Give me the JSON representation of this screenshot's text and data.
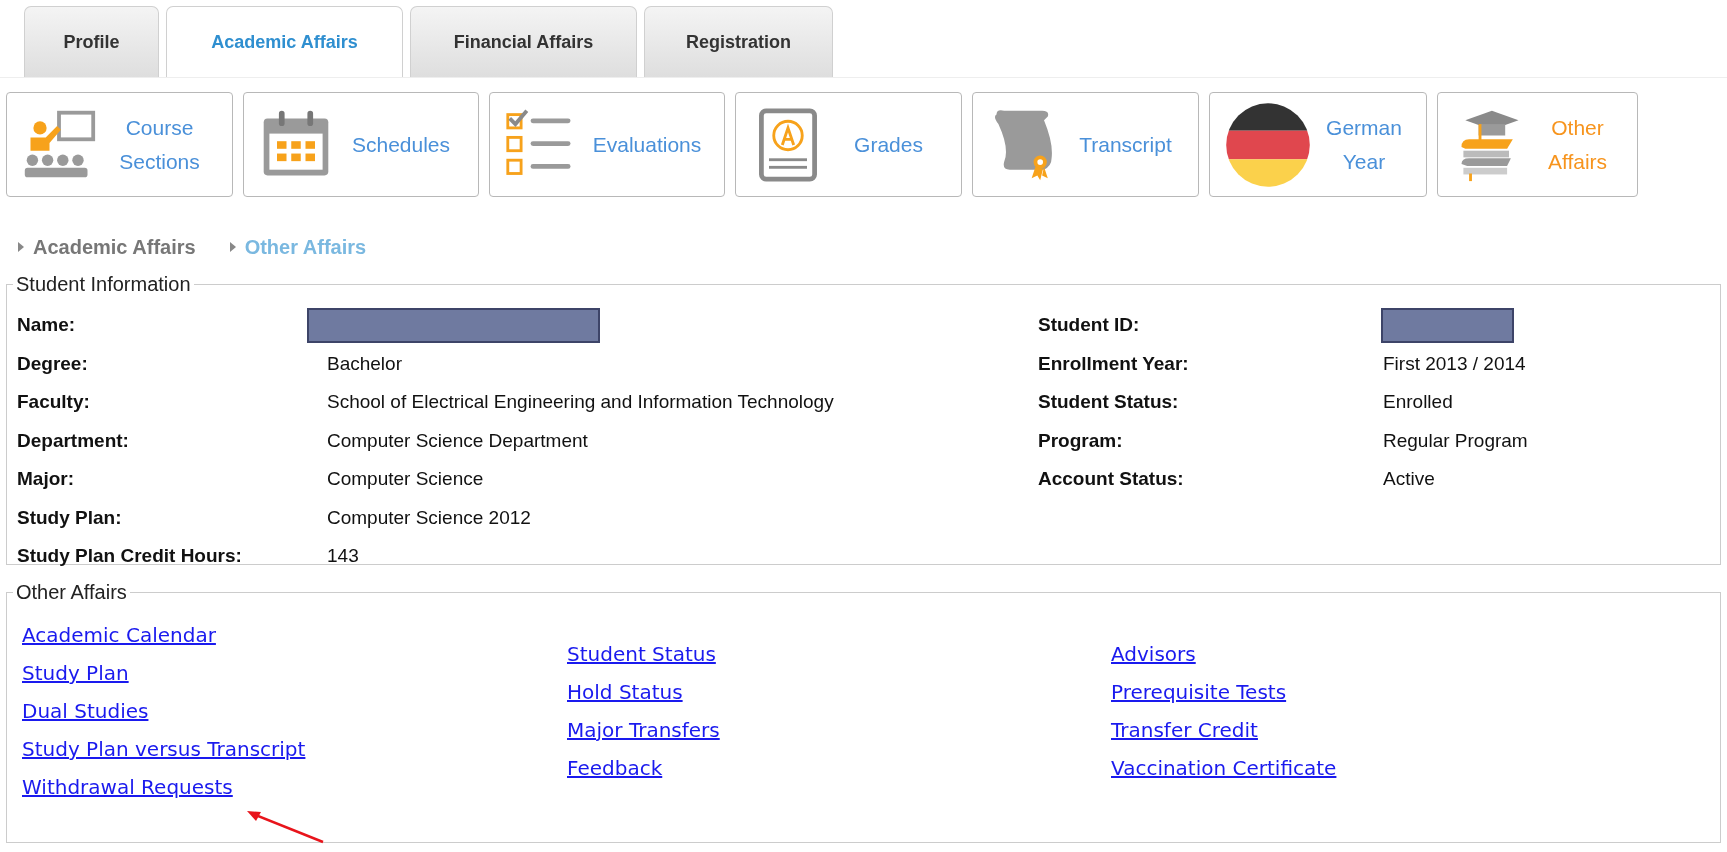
{
  "tabs": [
    {
      "label": "Profile",
      "selected": false
    },
    {
      "label": "Academic Affairs",
      "selected": true
    },
    {
      "label": "Financial Affairs",
      "selected": false
    },
    {
      "label": "Registration",
      "selected": false
    }
  ],
  "tiles": [
    {
      "label": "Course Sections",
      "selected": false
    },
    {
      "label": "Schedules",
      "selected": false
    },
    {
      "label": "Evaluations",
      "selected": false
    },
    {
      "label": "Grades",
      "selected": false
    },
    {
      "label": "Transcript",
      "selected": false
    },
    {
      "label": "German Year",
      "selected": false
    },
    {
      "label": "Other Affairs",
      "selected": true
    }
  ],
  "breadcrumb": [
    {
      "label": "Academic Affairs",
      "selected": false
    },
    {
      "label": "Other Affairs",
      "selected": true
    }
  ],
  "student_info": {
    "title": "Student Information",
    "left": [
      {
        "label": "Name:",
        "kind": "redacted"
      },
      {
        "label": "Degree:",
        "kind": "text",
        "value": "Bachelor"
      },
      {
        "label": "Faculty:",
        "kind": "text",
        "value": "School of Electrical Engineering and Information Technology"
      },
      {
        "label": "Department:",
        "kind": "text",
        "value": "Computer Science Department"
      },
      {
        "label": "Major:",
        "kind": "text",
        "value": "Computer Science"
      },
      {
        "label": "Study Plan:",
        "kind": "text",
        "value": "Computer Science 2012"
      },
      {
        "label": "Study Plan Credit Hours:",
        "kind": "text",
        "value": "143"
      }
    ],
    "right": [
      {
        "label": "Student ID:",
        "kind": "redacted"
      },
      {
        "label": "Enrollment Year:",
        "kind": "text",
        "value": "First 2013 / 2014"
      },
      {
        "label": "Student Status:",
        "kind": "text",
        "value": "Enrolled"
      },
      {
        "label": "Program:",
        "kind": "text",
        "value": "Regular Program"
      },
      {
        "label": "Account Status:",
        "kind": "text",
        "value": "Active"
      }
    ]
  },
  "other_affairs": {
    "title": "Other Affairs",
    "columns": [
      {
        "links": [
          "Academic Calendar",
          "Study Plan",
          "Dual Studies",
          "Study Plan versus Transcript",
          "Withdrawal Requests"
        ]
      },
      {
        "links": [
          "Student Status",
          "Hold Status",
          "Major Transfers",
          "Feedback"
        ]
      },
      {
        "links": [
          "Advisors",
          "Prerequisite Tests",
          "Transfer Credit",
          "Vaccination Certificate"
        ]
      }
    ]
  }
}
